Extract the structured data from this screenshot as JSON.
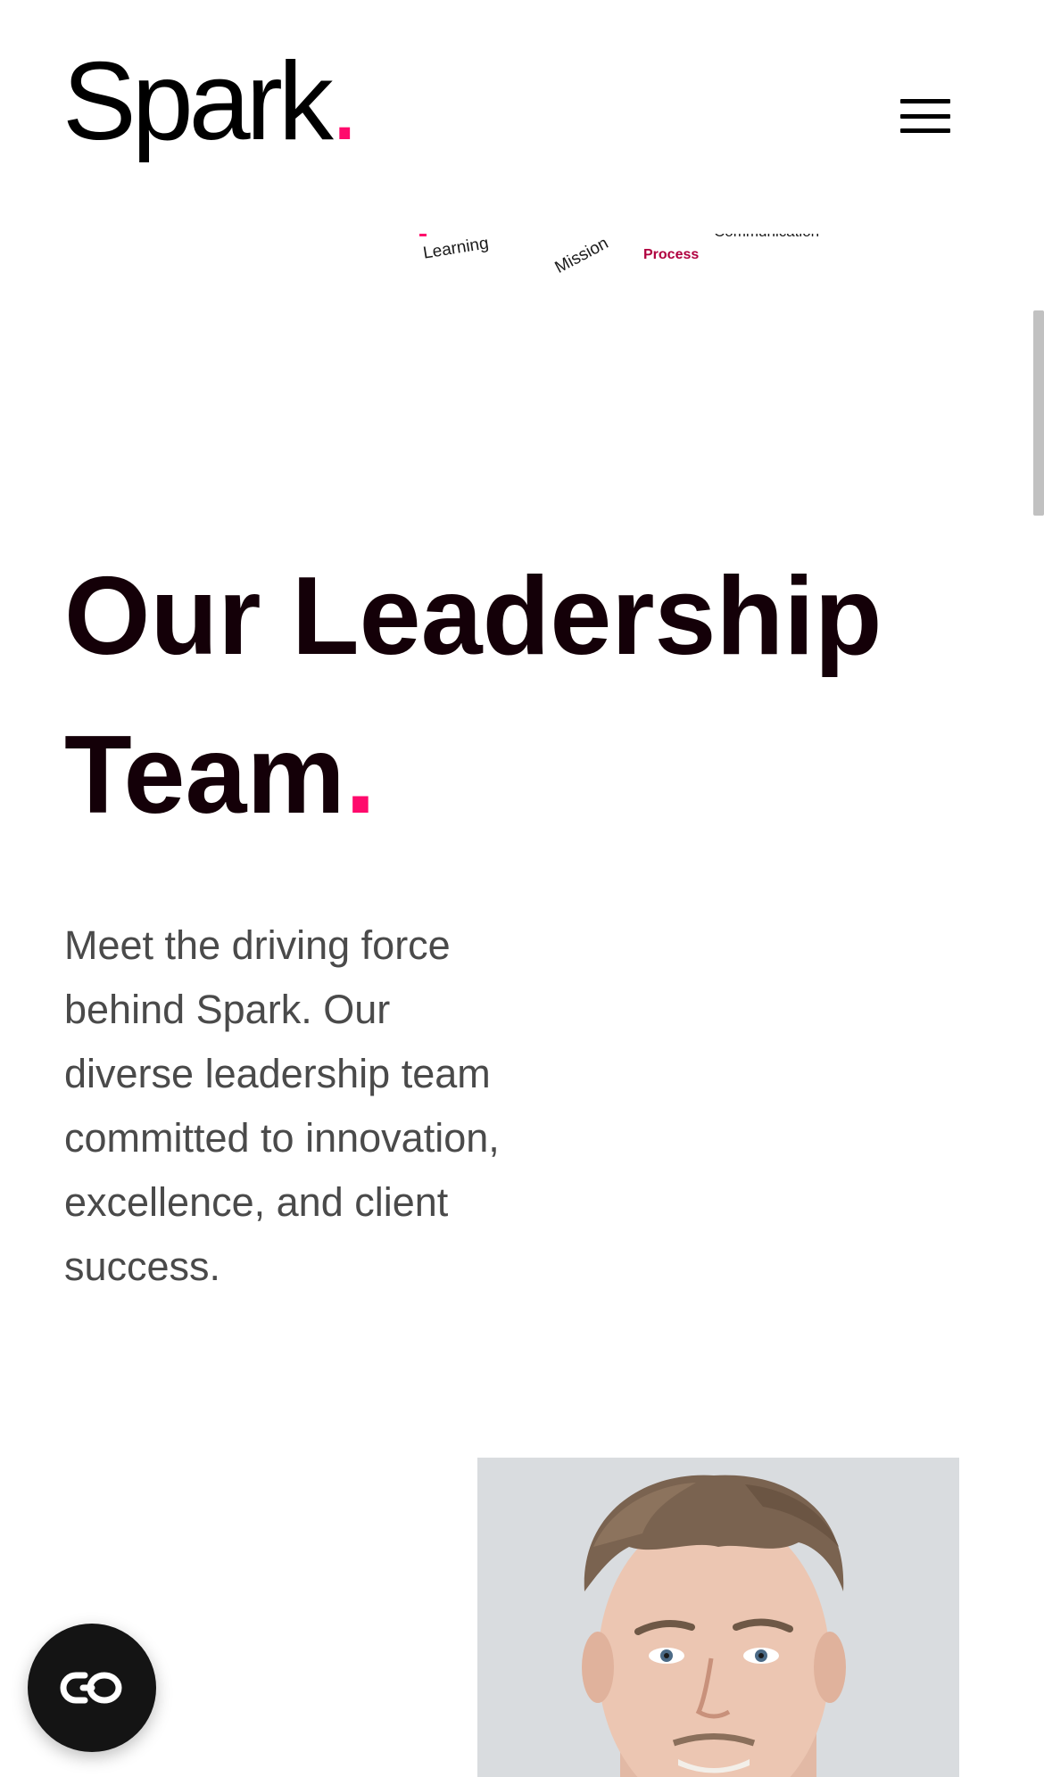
{
  "header": {
    "logo_text": "Spark",
    "logo_dot": ".",
    "menu_icon": "hamburger-menu-icon"
  },
  "word_cloud": {
    "words": [
      "Learning",
      "Mission",
      "Process",
      "Communication"
    ]
  },
  "hero": {
    "heading_line1": "Our Leadership",
    "heading_line2": "Team",
    "heading_dot": ".",
    "intro": "Meet the driving force behind Spark. Our diverse leadership team committed to innovation, excellence, and client success."
  },
  "team": {
    "photo_alt": "Leadership team member portrait"
  },
  "chat": {
    "icon": "chat-link-icon"
  },
  "colors": {
    "accent": "#ff0a6c",
    "heading": "#140008",
    "body_text": "#4a4a4a",
    "chat_bg": "#141414"
  }
}
